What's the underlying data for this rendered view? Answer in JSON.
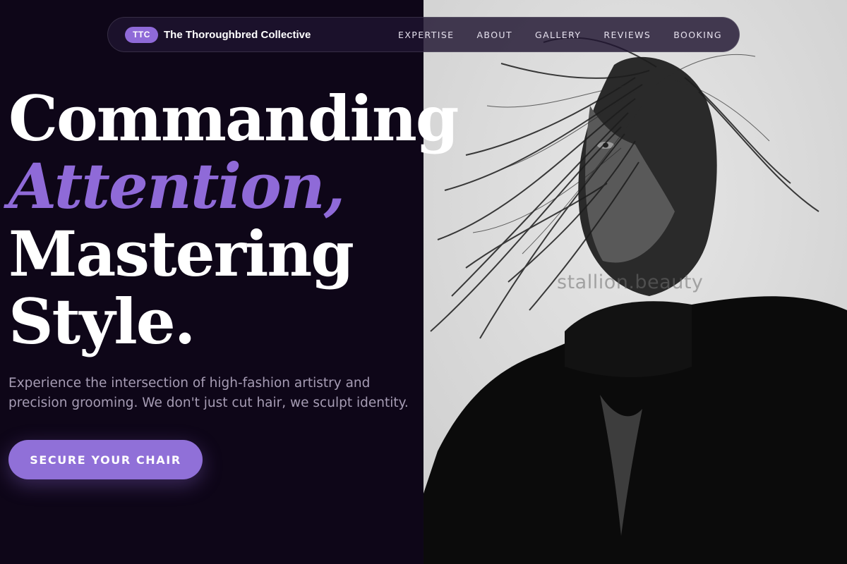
{
  "nav": {
    "badge": "TTC",
    "brand": "The Thoroughbred Collective",
    "links": [
      "EXPERTISE",
      "ABOUT",
      "GALLERY",
      "REVIEWS",
      "BOOKING"
    ]
  },
  "hero": {
    "headline_line1": "Commanding",
    "headline_accent": "Attention,",
    "headline_line3": "Mastering",
    "headline_line4": "Style.",
    "subtext": "Experience the intersection of high-fashion artistry and precision grooming. We don't just cut hair, we sculpt identity.",
    "cta_label": "SECURE YOUR CHAIR"
  },
  "photo": {
    "watermark": "stallion.beauty"
  },
  "colors": {
    "background": "#0e0618",
    "accent": "#8f6ad8",
    "text": "#ffffff",
    "muted_text": "#a69cb4"
  }
}
